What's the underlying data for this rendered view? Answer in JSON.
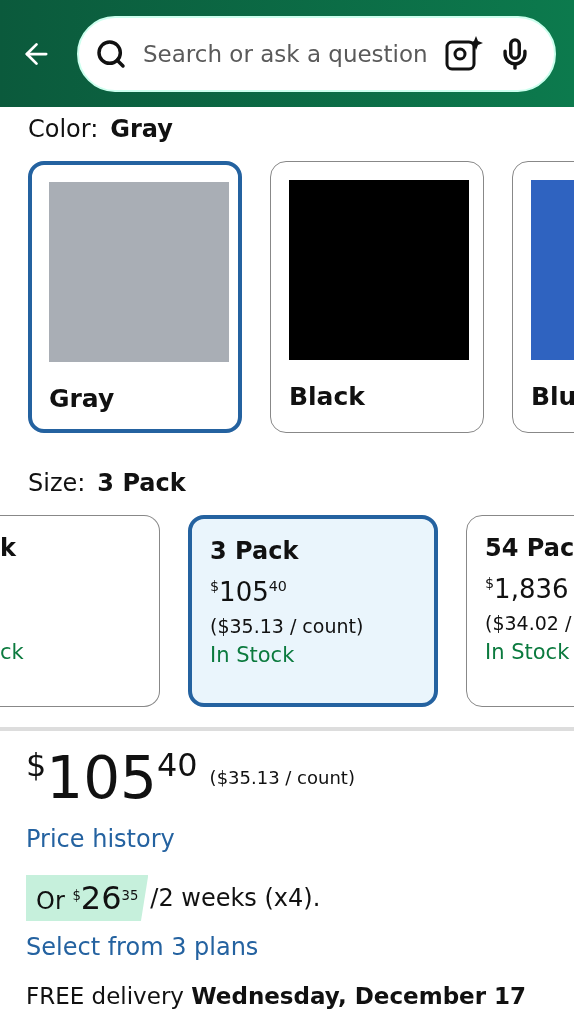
{
  "header": {
    "search": {
      "placeholder": "Search or ask a question"
    }
  },
  "color": {
    "label": "Color:",
    "value": "Gray"
  },
  "swatches": [
    {
      "name": "Gray",
      "color": "#a9aeb5",
      "selected": true
    },
    {
      "name": "Black",
      "color": "#000000",
      "selected": false
    },
    {
      "name": "Blu",
      "color": "#2f63c0",
      "selected": false
    }
  ],
  "size": {
    "label": "Size:",
    "value": "3 Pack"
  },
  "sizes": [
    {
      "kind": "cut-left",
      "name": "k",
      "stock": "ck",
      "selected": false
    },
    {
      "kind": "full",
      "name": "3 Pack",
      "price": {
        "currency": "$",
        "whole": "105",
        "fraction": "40"
      },
      "unit": "($35.13 / count)",
      "stock": "In Stock",
      "selected": true
    },
    {
      "kind": "cut-right",
      "name": "54 Pac",
      "price": {
        "currency": "$",
        "whole": "1,836"
      },
      "unit": "($34.02 /",
      "stock": "In Stock",
      "selected": false
    }
  ],
  "price": {
    "currency": "$",
    "whole": "105",
    "fraction": "40",
    "unit": "($35.13 / count)"
  },
  "price_history": "Price history",
  "installment": {
    "prefix": "Or",
    "currency": "$",
    "whole": "26",
    "fraction": "35",
    "suffix": "/2 weeks (x4)."
  },
  "plans_link": "Select from 3 plans",
  "delivery": "FREE delivery **Wednesday, December 17**"
}
